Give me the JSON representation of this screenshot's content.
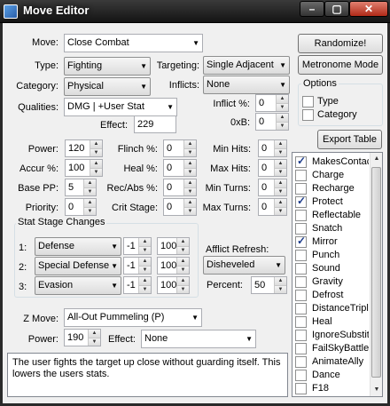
{
  "window": {
    "title": "Move Editor"
  },
  "move": {
    "label": "Move:",
    "value": "Close Combat"
  },
  "type": {
    "label": "Type:",
    "value": "Fighting"
  },
  "category": {
    "label": "Category:",
    "value": "Physical"
  },
  "qualities": {
    "label": "Qualities:",
    "value": "DMG | +User Stat"
  },
  "effect": {
    "label": "Effect:",
    "value": "229"
  },
  "targeting": {
    "label": "Targeting:",
    "value": "Single Adjacent"
  },
  "inflicts": {
    "label": "Inflicts:",
    "value": "None"
  },
  "inflict_pct": {
    "label": "Inflict %:",
    "value": "0"
  },
  "hex_box": {
    "label": "0xB:",
    "value": "0"
  },
  "buttons": {
    "randomize": "Randomize!",
    "metronome": "Metronome Mode",
    "export": "Export Table"
  },
  "options": {
    "title": "Options",
    "items": [
      {
        "label": "Type",
        "checked": false
      },
      {
        "label": "Category",
        "checked": false
      }
    ]
  },
  "stats": {
    "power": {
      "label": "Power:",
      "value": "120"
    },
    "accuracy": {
      "label": "Accur %:",
      "value": "100"
    },
    "base_pp": {
      "label": "Base PP:",
      "value": "5"
    },
    "priority": {
      "label": "Priority:",
      "value": "0"
    },
    "flinch": {
      "label": "Flinch %:",
      "value": "0"
    },
    "heal": {
      "label": "Heal %:",
      "value": "0"
    },
    "rec_abs": {
      "label": "Rec/Abs %:",
      "value": "0"
    },
    "crit_stage": {
      "label": "Crit Stage:",
      "value": "0"
    },
    "min_hits": {
      "label": "Min Hits:",
      "value": "0"
    },
    "max_hits": {
      "label": "Max Hits:",
      "value": "0"
    },
    "min_turns": {
      "label": "Min Turns:",
      "value": "0"
    },
    "max_turns": {
      "label": "Max Turns:",
      "value": "0"
    }
  },
  "stat_stage": {
    "title": "Stat Stage Changes",
    "rows": [
      {
        "index": "1:",
        "stat": "Defense",
        "stage": "-1",
        "chance": "100"
      },
      {
        "index": "2:",
        "stat": "Special Defense",
        "stage": "-1",
        "chance": "100"
      },
      {
        "index": "3:",
        "stat": "Evasion",
        "stage": "-1",
        "chance": "100"
      }
    ]
  },
  "afflict_refresh": {
    "label": "Afflict Refresh:",
    "value": "Disheveled",
    "percent_label": "Percent:",
    "percent_value": "50"
  },
  "zmove": {
    "label": "Z Move:",
    "value": "All-Out Pummeling (P)",
    "power_label": "Power:",
    "power_value": "190",
    "effect_label": "Effect:",
    "effect_value": "None"
  },
  "description": "The user fights the target up close without guarding itself. This lowers the users stats.",
  "flags": [
    {
      "label": "MakesContact",
      "checked": true
    },
    {
      "label": "Charge",
      "checked": false
    },
    {
      "label": "Recharge",
      "checked": false
    },
    {
      "label": "Protect",
      "checked": true
    },
    {
      "label": "Reflectable",
      "checked": false
    },
    {
      "label": "Snatch",
      "checked": false
    },
    {
      "label": "Mirror",
      "checked": true
    },
    {
      "label": "Punch",
      "checked": false
    },
    {
      "label": "Sound",
      "checked": false
    },
    {
      "label": "Gravity",
      "checked": false
    },
    {
      "label": "Defrost",
      "checked": false
    },
    {
      "label": "DistanceTriple",
      "checked": false
    },
    {
      "label": "Heal",
      "checked": false
    },
    {
      "label": "IgnoreSubstitute",
      "checked": false
    },
    {
      "label": "FailSkyBattle",
      "checked": false
    },
    {
      "label": "AnimateAlly",
      "checked": false
    },
    {
      "label": "Dance",
      "checked": false
    },
    {
      "label": "F18",
      "checked": false
    }
  ]
}
